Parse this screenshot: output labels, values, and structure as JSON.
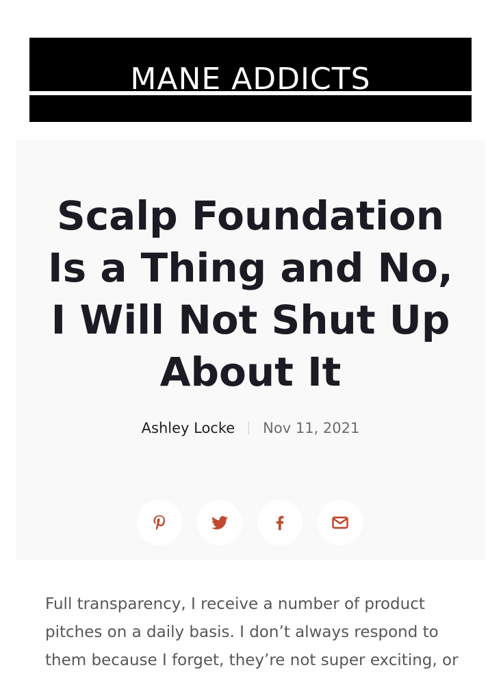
{
  "header": {
    "logo_text": "MANE ADDICTS"
  },
  "article": {
    "title": "Scalp Foundation Is a Thing and No, I Will Not Shut Up About It",
    "author": "Ashley Locke",
    "date": "Nov 11, 2021",
    "body": "Full transparency, I receive a number of product pitches on a daily basis. I don’t always respond to them because I forget, they’re not super exciting, or"
  },
  "share": {
    "accent_color": "#c0492e",
    "buttons": [
      {
        "icon": "pinterest-icon"
      },
      {
        "icon": "twitter-icon"
      },
      {
        "icon": "facebook-icon"
      },
      {
        "icon": "email-icon"
      }
    ]
  }
}
